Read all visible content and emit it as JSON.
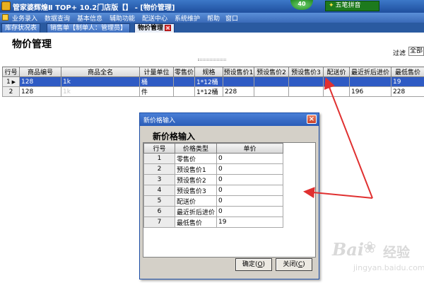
{
  "window": {
    "title": "管家婆辉煌Ⅱ TOP+ 10.2门店版【】 - [物价管理]",
    "badge": "40",
    "ime_label": "五笔拼音"
  },
  "menu": [
    "业务录入",
    "数据查询",
    "基本信息",
    "辅助功能",
    "配送中心",
    "系统维护",
    "帮助",
    "窗口"
  ],
  "tabs": [
    {
      "label": "库存状况表"
    },
    {
      "label": "销售单【制单人：管理员】"
    },
    {
      "label": "物价管理"
    }
  ],
  "page": {
    "title": "物价管理",
    "filter_label": "过滤",
    "filter_value": "全部"
  },
  "grid": {
    "columns": [
      "行号",
      "商品编号",
      "商品全名",
      "计量单位",
      "零售价",
      "规格",
      "预设售价1",
      "预设售价2",
      "预设售价3",
      "配送价",
      "最近折后进价",
      "最低售价"
    ],
    "rows": [
      {
        "num": "1",
        "code": "128",
        "name": "1k",
        "unit": "桶",
        "retail": "",
        "spec": "1*12桶",
        "p1": "",
        "p2": "",
        "p3": "",
        "dist": "",
        "recent": "",
        "min": "19"
      },
      {
        "num": "2",
        "code": "128",
        "name": "1k",
        "unit": "件",
        "retail": "",
        "spec": "1*12桶",
        "p1": "228",
        "p2": "",
        "p3": "",
        "dist": "",
        "recent": "196",
        "min": "228"
      }
    ]
  },
  "dialog": {
    "title": "新价格输入",
    "heading": "新价格输入",
    "columns": [
      "行号",
      "价格类型",
      "单价"
    ],
    "rows": [
      {
        "num": "1",
        "type": "零售价",
        "price": "0"
      },
      {
        "num": "2",
        "type": "预设售价1",
        "price": "0"
      },
      {
        "num": "3",
        "type": "预设售价2",
        "price": "0"
      },
      {
        "num": "4",
        "type": "预设售价3",
        "price": "0"
      },
      {
        "num": "5",
        "type": "配送价",
        "price": "0"
      },
      {
        "num": "6",
        "type": "最近折后进价",
        "price": "0"
      },
      {
        "num": "7",
        "type": "最低售价",
        "price": "19"
      }
    ],
    "ok_label": "确定",
    "ok_key": "O",
    "close_label": "关闭",
    "close_key": "C"
  },
  "watermark": {
    "logo": "Bai",
    "text": "经验",
    "url": "jingyan.baidu.com"
  },
  "colors": {
    "selection": "#2f5bc4",
    "titlebar": "#2a5cb8",
    "annotation_arrow": "#e03030"
  },
  "icons": {
    "app": "app-logo-icon",
    "close": "close-icon",
    "row_pointer": "row-pointer-icon",
    "paw": "baidu-paw-icon"
  }
}
